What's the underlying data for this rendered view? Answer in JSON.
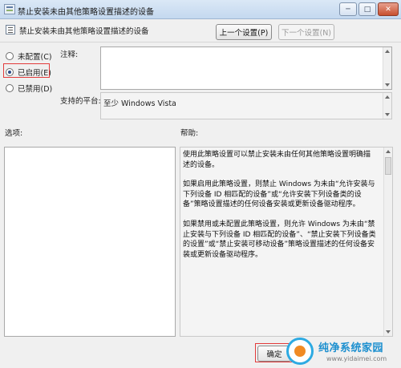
{
  "window": {
    "title": "禁止安装未由其他策略设置描述的设备",
    "controls": {
      "minimize": "─",
      "maximize": "□",
      "close": "✕"
    }
  },
  "header": {
    "title": "禁止安装未由其他策略设置描述的设备",
    "prev_button": "上一个设置(P)",
    "next_button": "下一个设置(N)"
  },
  "state_options": [
    {
      "label": "未配置(C)",
      "selected": false
    },
    {
      "label": "已启用(E)",
      "selected": true
    },
    {
      "label": "已禁用(D)",
      "selected": false
    }
  ],
  "comment": {
    "label": "注释:",
    "value": ""
  },
  "platform": {
    "label": "支持的平台:",
    "value": "至少 Windows Vista"
  },
  "options": {
    "label": "选项:"
  },
  "help": {
    "label": "帮助:",
    "paragraphs": [
      "使用此策略设置可以禁止安装未由任何其他策略设置明确描述的设备。",
      "如果启用此策略设置，则禁止 Windows 为未由“允许安装与下列设备 ID 相匹配的设备”或“允许安装下列设备类的设备”策略设置描述的任何设备安装或更新设备驱动程序。",
      "如果禁用或未配置此策略设置，则允许 Windows 为未由“禁止安装与下列设备 ID 相匹配的设备”、“禁止安装下列设备类的设置”或“禁止安装可移动设备”策略设置描述的任何设备安装或更新设备驱动程序。"
    ]
  },
  "footer": {
    "ok_button": "确定"
  },
  "watermark": {
    "title": "纯净系统家园",
    "url": "www.yidaimei.com"
  },
  "colors": {
    "highlight": "#e23b3b",
    "radio_dot": "#2c4b87",
    "watermark_blue": "#1c8fcf",
    "watermark_orange": "#f08a24"
  }
}
